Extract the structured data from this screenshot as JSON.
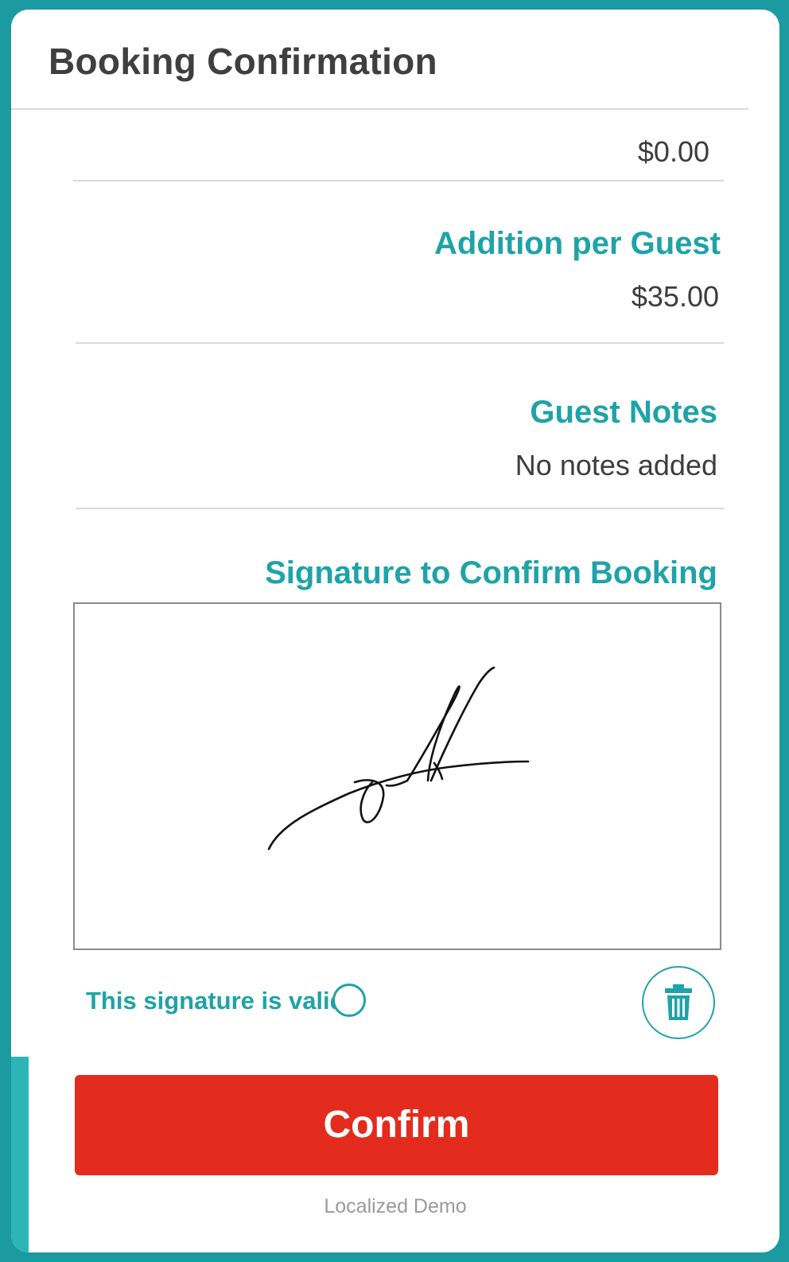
{
  "header": {
    "title": "Booking Confirmation"
  },
  "pricing": {
    "top_amount": "$0.00",
    "addition_label": "Addition per Guest",
    "addition_amount": "$35.00"
  },
  "notes": {
    "label": "Guest Notes",
    "value": "No notes added"
  },
  "signature": {
    "label": "Signature to Confirm Booking",
    "valid_label": "This signature is valid",
    "valid_checked": false
  },
  "actions": {
    "confirm_label": "Confirm",
    "clear_icon": "trash-icon"
  },
  "footer": {
    "text": "Localized Demo"
  },
  "colors": {
    "frame": "#1b9aa0",
    "accent": "#1ea3a8",
    "confirm": "#e32b1e",
    "title": "#3f3f3f"
  }
}
